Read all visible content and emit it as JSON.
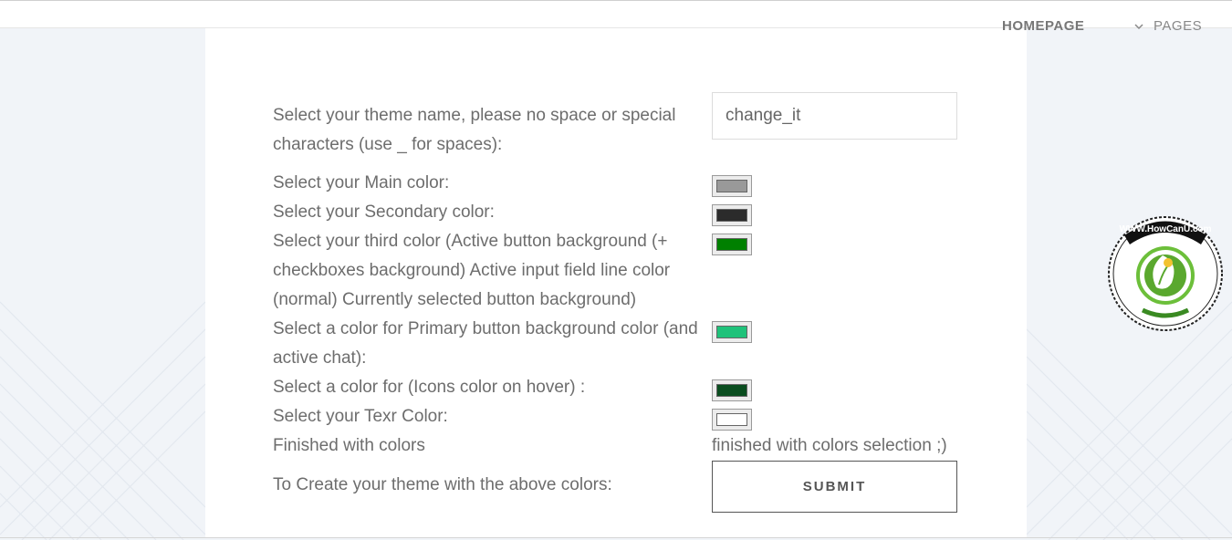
{
  "nav": {
    "homepage": "HOMEPAGE",
    "pages": "PAGES"
  },
  "form": {
    "theme_name": {
      "label": "Select your theme name, please no space or special characters (use _ for spaces):",
      "value": "change_it"
    },
    "colors": [
      {
        "label": "Select your Main color:",
        "color": "#999999"
      },
      {
        "label": "Select your Secondary color:",
        "color": "#2b2b2b"
      },
      {
        "label": "Select your third color (Active button background (+ checkboxes background) Active input field line color (normal) Currently selected button background)",
        "color": "#008000"
      },
      {
        "label": "Select a color for Primary button background color (and active chat):",
        "color": "#1fc27a"
      },
      {
        "label": "Select a color for (Icons color on hover) :",
        "color": "#0a4d1f"
      },
      {
        "label": "Select your Texr Color:",
        "color": "#ffffff"
      }
    ],
    "finished": {
      "label": "Finished with colors",
      "note": "finished with colors selection ;)"
    },
    "submit": {
      "label": "To Create your theme with the above colors:",
      "button": "SUBMIT"
    }
  },
  "logo": {
    "text": "WWW.HowCanU.com",
    "icon": "leaf-bulb-logo"
  }
}
